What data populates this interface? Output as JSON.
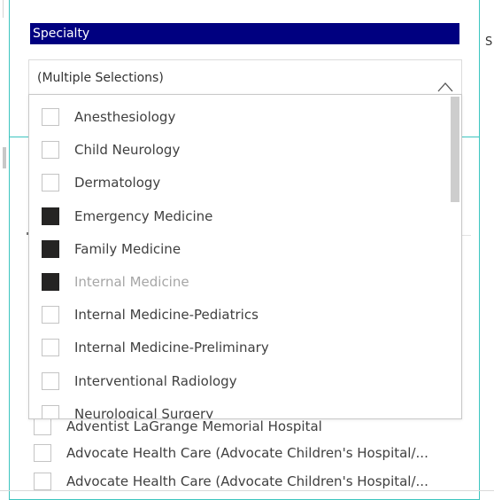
{
  "slicer": {
    "header": "Specialty",
    "selected_value": "(Multiple Selections)",
    "options": [
      {
        "label": "Anesthesiology",
        "checked": false,
        "dim": false
      },
      {
        "label": "Child Neurology",
        "checked": false,
        "dim": false
      },
      {
        "label": "Dermatology",
        "checked": false,
        "dim": false
      },
      {
        "label": "Emergency Medicine",
        "checked": true,
        "dim": false
      },
      {
        "label": "Family Medicine",
        "checked": true,
        "dim": false
      },
      {
        "label": "Internal Medicine",
        "checked": true,
        "dim": true
      },
      {
        "label": "Internal Medicine-Pediatrics",
        "checked": false,
        "dim": false
      },
      {
        "label": "Internal Medicine-Preliminary",
        "checked": false,
        "dim": false
      },
      {
        "label": "Interventional Radiology",
        "checked": false,
        "dim": false
      },
      {
        "label": "Neurological Surgery",
        "checked": false,
        "dim": false
      }
    ]
  },
  "background_list": {
    "items": [
      "Adventist LaGrange Memorial Hospital",
      "Advocate Health Care (Advocate Children's Hospital/...",
      "Advocate Health Care (Advocate Children's Hospital/..."
    ]
  },
  "right_fragment": "S",
  "icons": {
    "dropdown_chevron": "chevron-up-icon",
    "checkbox": "checkbox-icon"
  },
  "colors": {
    "header_bg": "#000080",
    "panel_border": "#3cc5bf",
    "checked": "#252423"
  }
}
